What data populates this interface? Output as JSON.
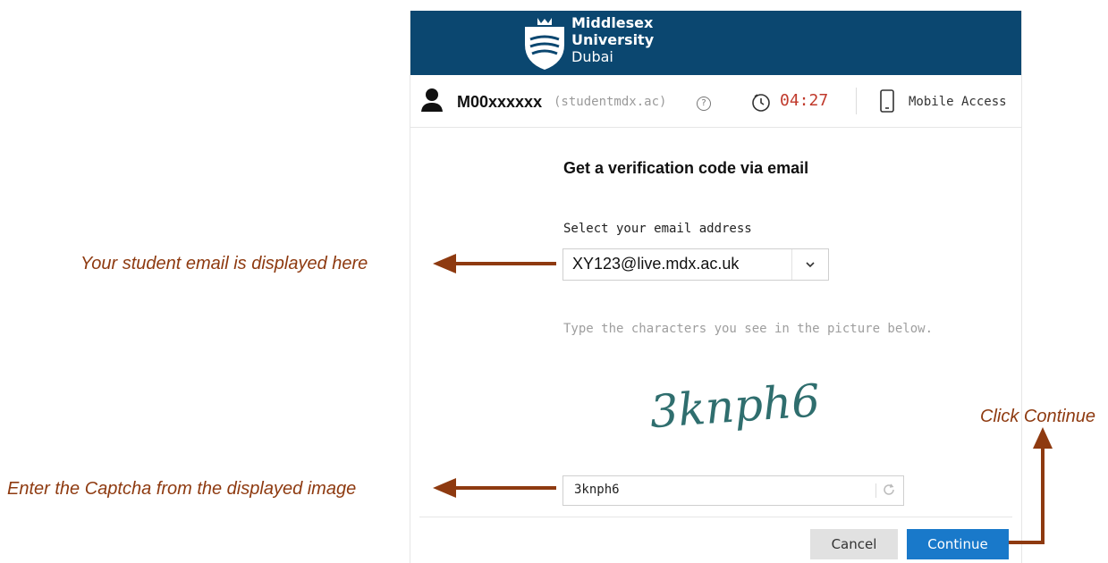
{
  "header": {
    "logo_line1": "Middlesex",
    "logo_line2": "University",
    "logo_line3": "Dubai"
  },
  "userbar": {
    "user_id": "M00xxxxxx",
    "domain": "(studentmdx.ac)",
    "help_symbol": "?",
    "timer": "04:27",
    "mobile_label": "Mobile Access"
  },
  "form": {
    "title": "Get a verification code via email",
    "email_label": "Select your email address",
    "email_selected": "XY123@live.mdx.ac.uk",
    "captcha_hint": "Type the characters you see in the picture below.",
    "captcha_image_text": "3knph6",
    "captcha_value": "3knph6"
  },
  "footer": {
    "cancel_label": "Cancel",
    "continue_label": "Continue"
  },
  "annotations": {
    "email_note": "Your student email is displayed here",
    "captcha_note": "Enter the Captcha from the displayed image",
    "continue_note": "Click Continue"
  },
  "colors": {
    "header_bg": "#0b4770",
    "timer": "#c0392b",
    "continue_bg": "#1979ca",
    "annotation": "#8e3a10"
  },
  "icons": {
    "logo": "university-shield-icon",
    "user": "user-icon",
    "help": "help-circle-icon",
    "timer": "timer-icon",
    "mobile": "mobile-phone-icon",
    "dropdown": "chevron-down-icon",
    "refresh": "refresh-icon"
  }
}
